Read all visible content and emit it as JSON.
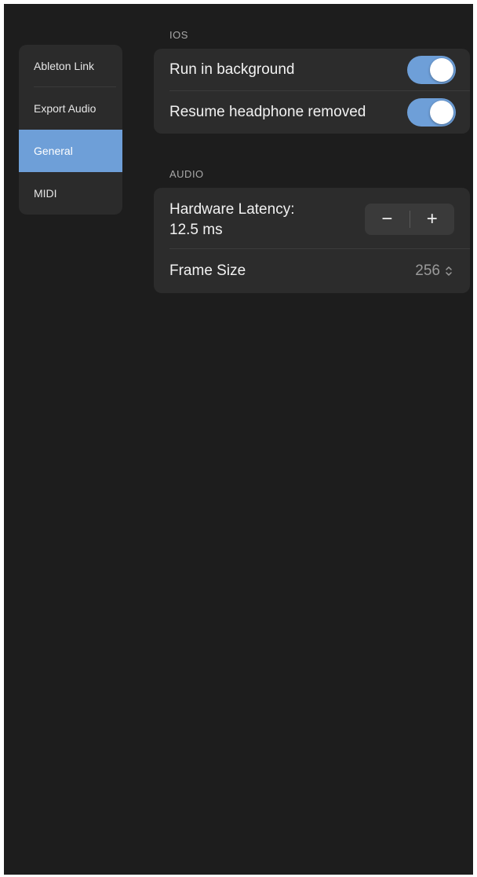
{
  "sidebar": {
    "items": [
      {
        "label": "Ableton Link",
        "active": false
      },
      {
        "label": "Export Audio",
        "active": false
      },
      {
        "label": "General",
        "active": true
      },
      {
        "label": "MIDI",
        "active": false
      }
    ]
  },
  "ios": {
    "header": "IOS",
    "run_in_background": {
      "label": "Run in background",
      "enabled": true
    },
    "resume_headphone": {
      "label": "Resume headphone removed",
      "enabled": true
    }
  },
  "audio": {
    "header": "AUDIO",
    "latency": {
      "label": "Hardware Latency:",
      "value": "12.5 ms",
      "minus": "−",
      "plus": "+"
    },
    "frame_size": {
      "label": "Frame Size",
      "value": "256"
    }
  },
  "colors": {
    "accent": "#6e9fd8",
    "background": "#1d1d1d",
    "card": "#2c2c2c"
  }
}
